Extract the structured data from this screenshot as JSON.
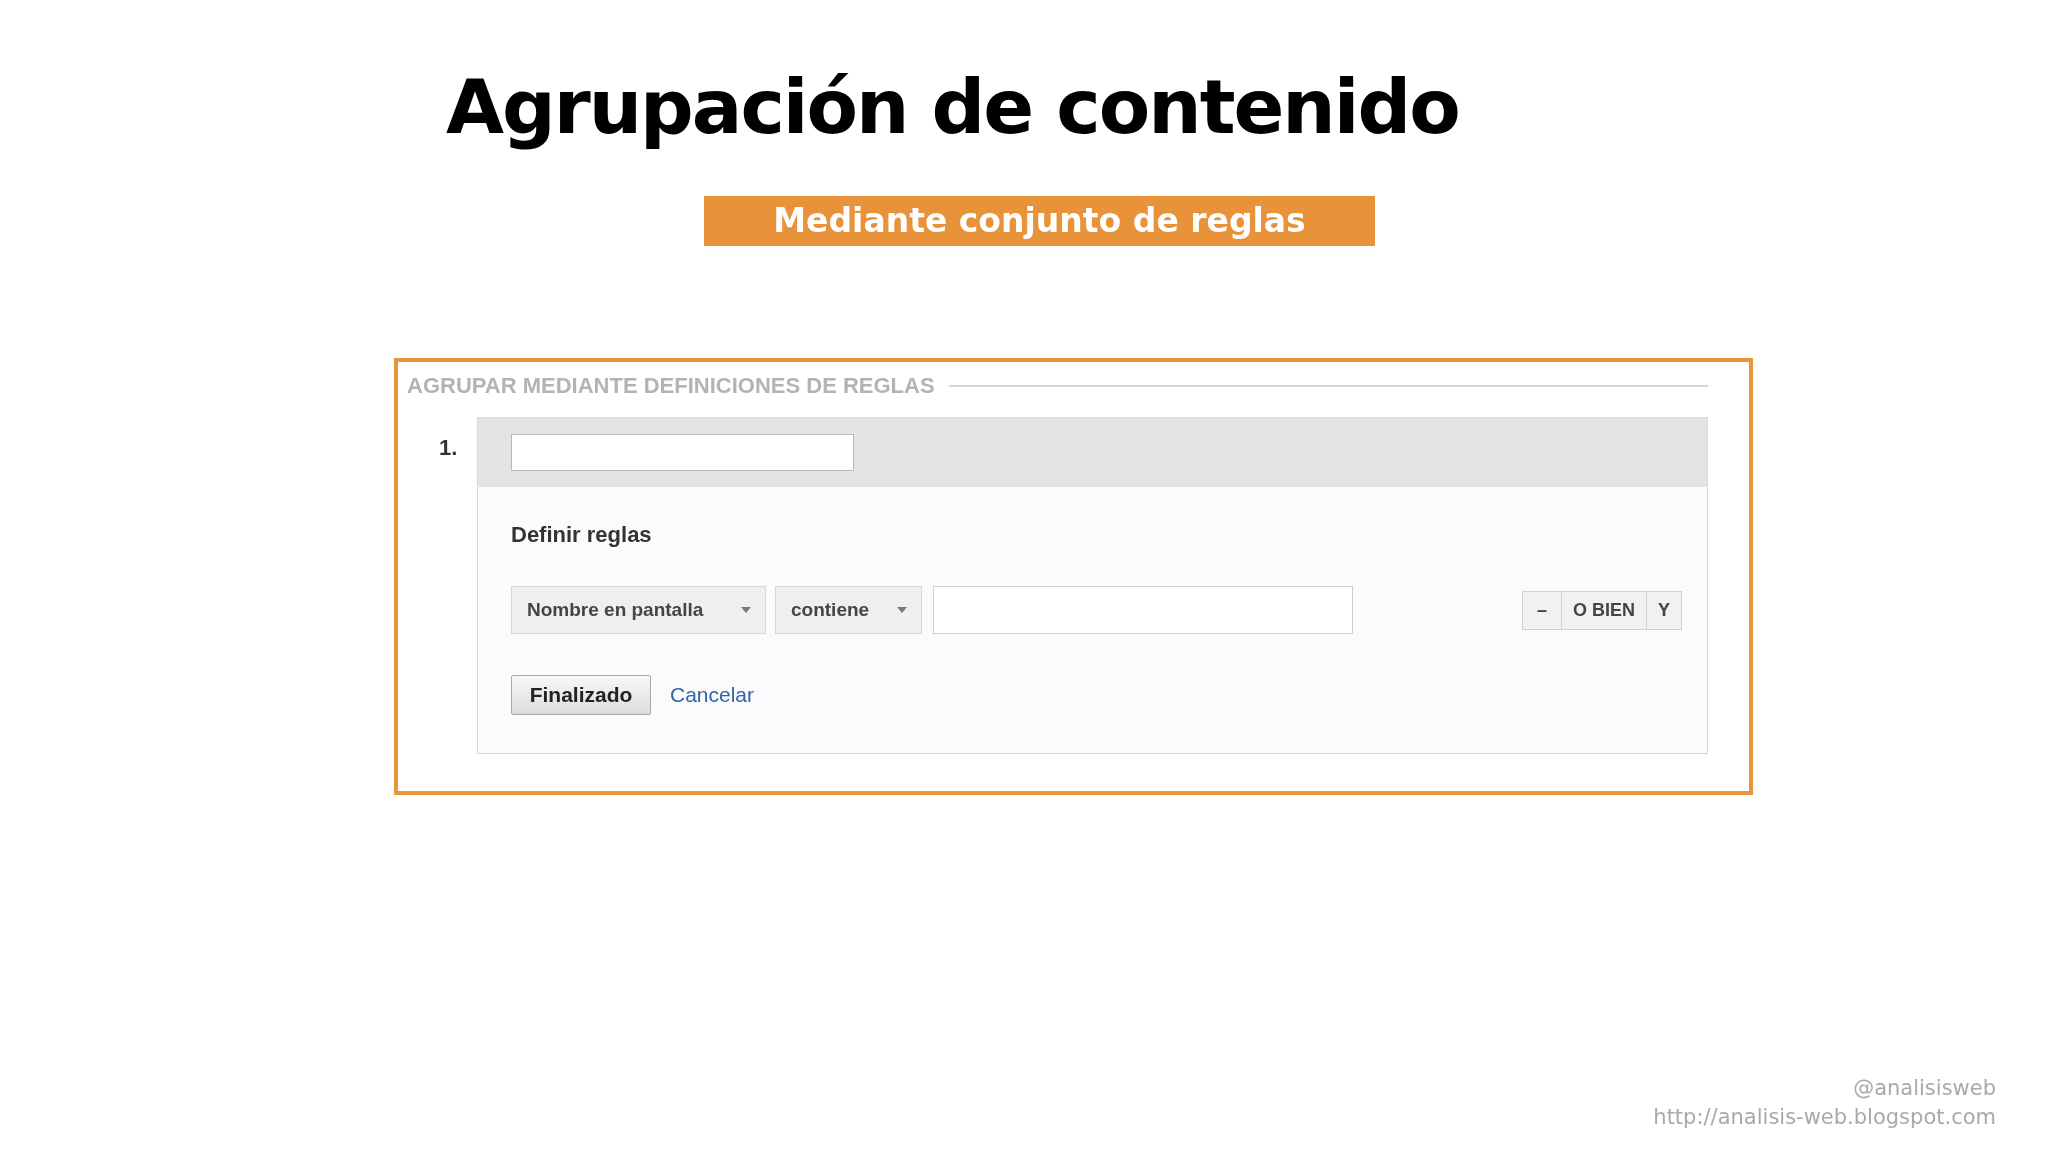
{
  "title": "Agrupación de contenido",
  "subtitle_banner": "Mediante conjunto de reglas",
  "panel": {
    "heading": "AGRUPAR MEDIANTE DEFINICIONES DE REGLAS",
    "groups": [
      {
        "number": "1.",
        "rules_heading": "Definir reglas",
        "rules": [
          {
            "dimension": "Nombre en pantalla",
            "operator": "contiene",
            "logic_buttons": [
              "–",
              "O BIEN",
              "Y"
            ]
          }
        ],
        "done_button": "Finalizado",
        "cancel_link": "Cancelar"
      }
    ]
  },
  "footer": {
    "handle": "@analisisweb",
    "url": "http://analisis-web.blogspot.com"
  }
}
